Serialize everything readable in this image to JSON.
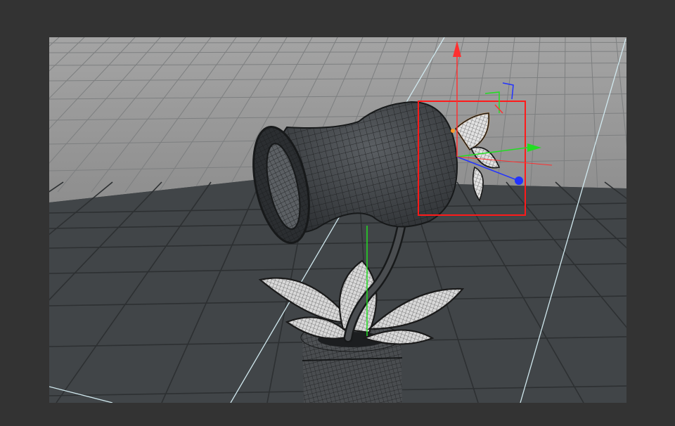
{
  "viewport": {
    "colors": {
      "app_background": "#333333",
      "back_grid_surface": "#9c9c9c",
      "floor_surface": "#414548",
      "grid_line": "#303335",
      "model_fill": "#46494c",
      "wire_line": "#17191a",
      "leaf_fill": "#dcdcdc",
      "selection_box": "#ff1a1a",
      "axis_x": "#ff3030",
      "axis_y": "#22dd22",
      "axis_z": "#2233ff",
      "selected_outline": "#ff9a2a",
      "light_guide": "#d0e8ee"
    },
    "icons": {
      "gizmo": "translate-gizmo-icon",
      "view_axis": "axis-tripod-icon"
    },
    "objects": [
      "flower-head-mesh",
      "petal-mesh",
      "stem-mesh",
      "leaf-mesh",
      "flower-pot-mesh"
    ]
  }
}
